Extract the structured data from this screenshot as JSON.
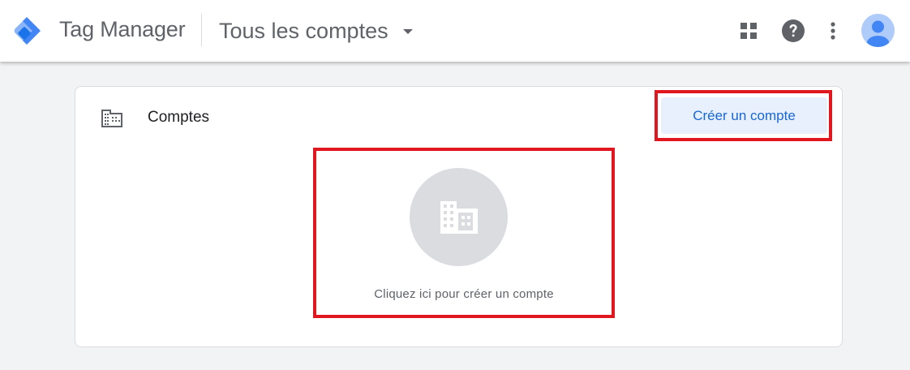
{
  "header": {
    "app_name": "Tag Manager",
    "account_selector": "Tous les comptes",
    "icons": [
      "apps-icon",
      "help-icon",
      "more-vert-icon",
      "account-avatar-icon"
    ]
  },
  "accounts_card": {
    "title": "Comptes",
    "create_button_label": "Créer un compte",
    "empty_state_text": "Cliquez ici pour créer un compte"
  },
  "colors": {
    "accent_blue": "#1967d2",
    "button_bg": "#e8f0fe",
    "highlight_red": "#e0171f",
    "page_bg": "#f1f3f4"
  }
}
